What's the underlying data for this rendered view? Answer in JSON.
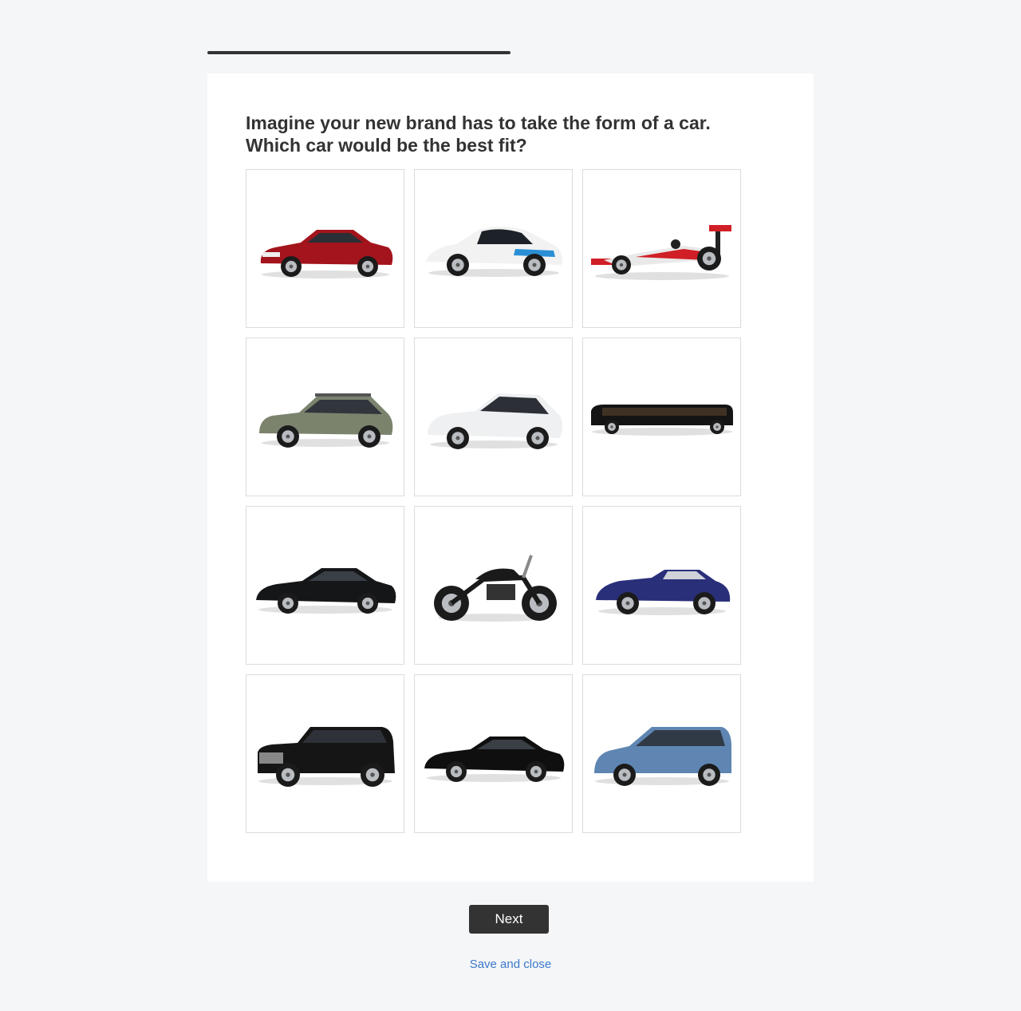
{
  "progress": {
    "fraction": 0.5
  },
  "question": {
    "text": "Imagine your new brand has to take the form of a car.\nWhich car would be the best fit?"
  },
  "options": [
    {
      "icon": "classic-muscle-car-icon",
      "color": "#a3141c",
      "kind": "coupe"
    },
    {
      "icon": "concept-sports-car-icon",
      "color": "#f2f2f2",
      "accent": "#2a8fd4",
      "kind": "concept"
    },
    {
      "icon": "formula-one-car-icon",
      "color": "#d01f26",
      "kind": "f1"
    },
    {
      "icon": "station-wagon-icon",
      "color": "#7b836d",
      "kind": "wagon"
    },
    {
      "icon": "hybrid-hatchback-icon",
      "color": "#eef0f2",
      "kind": "hatch"
    },
    {
      "icon": "stretch-limousine-icon",
      "color": "#141414",
      "kind": "limo"
    },
    {
      "icon": "luxury-sedan-icon",
      "color": "#141618",
      "kind": "sedan"
    },
    {
      "icon": "motorcycle-icon",
      "color": "#1a1a1a",
      "kind": "moto"
    },
    {
      "icon": "convertible-sports-car-icon",
      "color": "#2a2f7a",
      "kind": "convertible"
    },
    {
      "icon": "full-size-suv-icon",
      "color": "#151515",
      "kind": "suv"
    },
    {
      "icon": "electric-sedan-icon",
      "color": "#0f0f0f",
      "kind": "sedan"
    },
    {
      "icon": "minivan-icon",
      "color": "#5f86b3",
      "kind": "minivan"
    }
  ],
  "actions": {
    "next_label": "Next",
    "save_label": "Save and close"
  }
}
